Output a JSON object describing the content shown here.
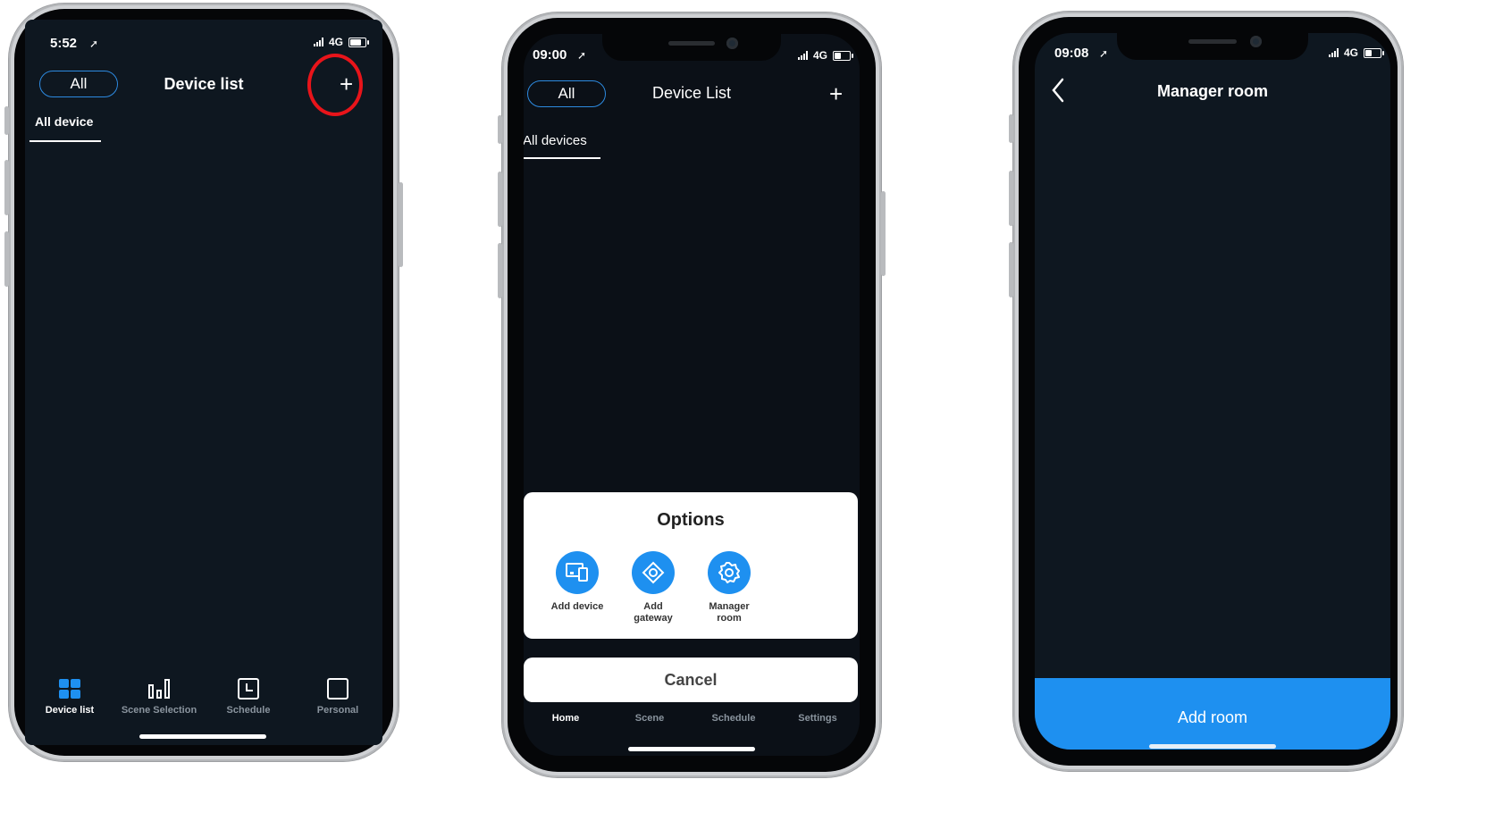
{
  "screen1": {
    "status": {
      "time": "5:52",
      "network": "4G"
    },
    "header": {
      "filter_label": "All",
      "title": "Device list",
      "add_icon": "plus-icon"
    },
    "tab": {
      "label": "All device"
    },
    "nav": [
      {
        "label": "Device list",
        "icon": "grid-icon",
        "active": true
      },
      {
        "label": "Scene Selection",
        "icon": "scene-icon",
        "active": false
      },
      {
        "label": "Schedule",
        "icon": "clock-icon",
        "active": false
      },
      {
        "label": "Personal",
        "icon": "square-icon",
        "active": false
      }
    ],
    "highlight_color": "#e8141a"
  },
  "screen2": {
    "status": {
      "time": "09:00",
      "network": "4G"
    },
    "header": {
      "filter_label": "All",
      "title": "Device List",
      "add_icon": "plus-icon"
    },
    "tab": {
      "label": "All devices"
    },
    "options_sheet": {
      "title": "Options",
      "items": [
        {
          "label": "Add device",
          "icon": "device-icon"
        },
        {
          "label": "Add gateway",
          "icon": "gateway-icon"
        },
        {
          "label": "Manager room",
          "icon": "gear-icon"
        }
      ],
      "cancel_label": "Cancel"
    },
    "nav": [
      {
        "label": "Home"
      },
      {
        "label": "Scene"
      },
      {
        "label": "Schedule"
      },
      {
        "label": "Settings"
      }
    ]
  },
  "screen3": {
    "status": {
      "time": "09:08",
      "network": "4G"
    },
    "header": {
      "back_icon": "chevron-left-icon",
      "title": "Manager room"
    },
    "add_room_label": "Add room"
  },
  "colors": {
    "accent": "#1e90f0",
    "screen_bg": "#0e1720",
    "highlight": "#e8141a"
  }
}
